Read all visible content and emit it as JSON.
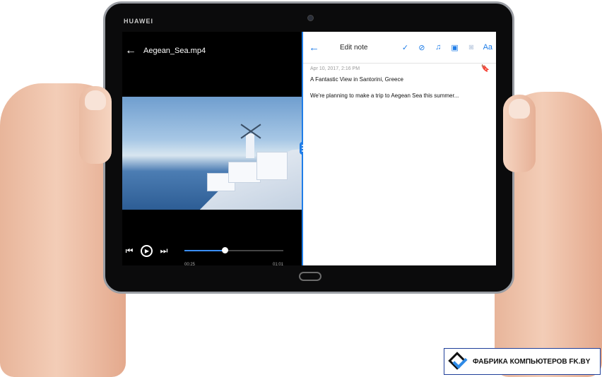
{
  "device": {
    "brand": "HUAWEI"
  },
  "video": {
    "title": "Aegean_Sea.mp4",
    "current_time": "00:25",
    "duration": "01:01",
    "progress_fraction": 0.41
  },
  "note": {
    "toolbar_title": "Edit note",
    "font_button_label": "Aa",
    "date": "Apr 10, 2017, 2:16 PM",
    "title": "A Fantastic View in Santorini, Greece",
    "body": "We're planning to make a trip to Aegean Sea this summer..."
  },
  "watermark": {
    "text": "ФАБРИКА КОМПЬЮТЕРОВ FK.BY"
  },
  "colors": {
    "accent": "#1f7de8",
    "video_bg": "#000000",
    "note_bg": "#ffffff"
  },
  "icons": {
    "video_back": "arrow-left-icon",
    "prev": "skip-previous-icon",
    "play": "play-icon",
    "next": "skip-next-icon",
    "note_back": "arrow-left-icon",
    "confirm": "check-icon",
    "checklist": "check-circle-icon",
    "reminder": "bell-icon",
    "image": "image-icon",
    "camera": "camera-icon",
    "bookmark": "bookmark-icon"
  }
}
